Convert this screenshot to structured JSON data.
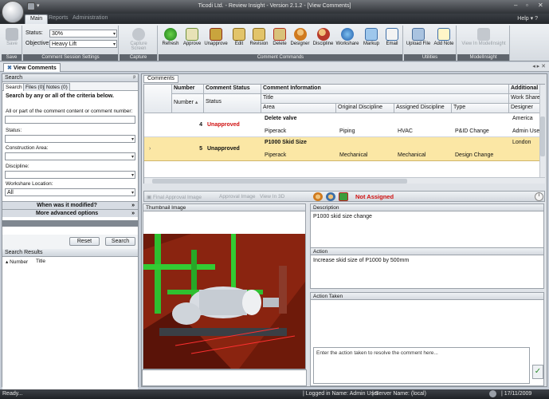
{
  "window": {
    "title": "Ticodi Ltd. - Review Insight - Version 2.1.2 - [View Comments]"
  },
  "ribbon_tabs": [
    "Main",
    "Reports",
    "Administration"
  ],
  "help_label": "Help",
  "ribbon": {
    "status_label": "Status:",
    "status_value": "30%",
    "objective_label": "Objective:",
    "objective_value": "Heavy Lift",
    "save_label": "Save",
    "capture_screen_label": "Capture Screen",
    "commands": [
      "Refresh",
      "Approve",
      "Unapprove",
      "Edit",
      "Revision",
      "Delete",
      "Designer",
      "Discipline",
      "Workshare",
      "Markup",
      "Email"
    ],
    "utilities": [
      "Upload File",
      "Add Note"
    ],
    "modelinsight": [
      "View In ModelInsight"
    ],
    "groups": [
      "Save",
      "Comment Session Settings",
      "Capture",
      "Comment Commands",
      "Utilities",
      "ModelInsight"
    ]
  },
  "doc_tab": "View Comments",
  "left": {
    "header": "Search",
    "tabs": [
      "Search",
      "Files (0)",
      "Notes (0)"
    ],
    "intro": "Search by any or all of the  criteria below.",
    "f_comment": "All or part of the comment content or comment number:",
    "f_status": "Status:",
    "f_area": "Construction Area:",
    "f_discipline": "Discipline:",
    "f_workshare": "Workshare Location:",
    "workshare_value": "All",
    "when_modified": "When was it modified?",
    "more_options": "More advanced options",
    "reset": "Reset",
    "search": "Search",
    "results_header": "Search Results",
    "results_cols": [
      "Number",
      "Title"
    ]
  },
  "comments": {
    "header": "Comments",
    "cols": {
      "number": "Number",
      "status": "Comment Status",
      "info": "Comment Information",
      "additional": "Additional"
    },
    "sub": {
      "number": "Number",
      "status": "Status",
      "title": "Title",
      "area": "Area",
      "orig": "Original Discipline",
      "assigned": "Assigned Discipline",
      "type": "Type",
      "workshare": "Work Share",
      "designer": "Designer"
    },
    "rows": [
      {
        "number": "4",
        "status": "Unapproved",
        "title": "Delete valve",
        "area": "Piperack",
        "orig": "Piping",
        "assigned": "HVAC",
        "type": "P&ID Change",
        "workshare": "America",
        "designer": "Admin User"
      },
      {
        "number": "5",
        "status": "Unapproved",
        "title": "P1000 Skid Size",
        "area": "Piperack",
        "orig": "Mechanical",
        "assigned": "Mechanical",
        "type": "Design Change",
        "workshare": "London",
        "designer": ""
      }
    ]
  },
  "toolbar2": {
    "final_approval": "Final Approval Image",
    "approval": "Approval Image",
    "view3d": "View In 3D",
    "not_assigned": "Not Assigned"
  },
  "thumbnail_header": "Thumbnail Image",
  "description": {
    "header": "Description",
    "text": "P1000 skid size change"
  },
  "action": {
    "header": "Action",
    "text": "Increase skid size of P1000 by 500mm"
  },
  "action_taken": {
    "header": "Action Taken",
    "placeholder": "Enter the action taken to resolve the comment here..."
  },
  "status_bar": {
    "ready": "Ready...",
    "logged_in": "Logged in Name: Admin User",
    "server": "Server Name: (local)",
    "date": "17/11/2009"
  }
}
